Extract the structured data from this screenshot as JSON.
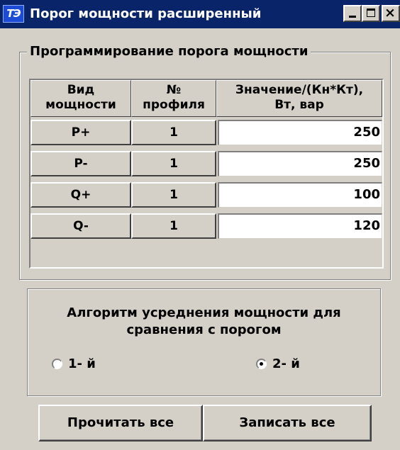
{
  "window": {
    "icon_text": "ТЭ",
    "title": "Порог мощности расширенный"
  },
  "group_programming": {
    "legend": "Программирование порога мощности"
  },
  "table": {
    "headers": [
      "Вид\nмощности",
      "№\nпрофиля",
      "Значение/(Кн*Кт),\nВт, вар"
    ],
    "rows": [
      {
        "type": "P+",
        "profile": "1",
        "value": "250"
      },
      {
        "type": "P-",
        "profile": "1",
        "value": "250"
      },
      {
        "type": "Q+",
        "profile": "1",
        "value": "100"
      },
      {
        "type": "Q-",
        "profile": "1",
        "value": "120"
      }
    ]
  },
  "algorithm": {
    "title": "Алгоритм усреднения мощности для\nсравнения с порогом",
    "options": [
      {
        "label": "1- й",
        "selected": false
      },
      {
        "label": "2- й",
        "selected": true
      }
    ]
  },
  "buttons": {
    "read_all": "Прочитать все",
    "write_all": "Записать все"
  },
  "colors": {
    "titlebar": "#0a246a",
    "face": "#d4d0c8",
    "field": "#ffffff"
  }
}
